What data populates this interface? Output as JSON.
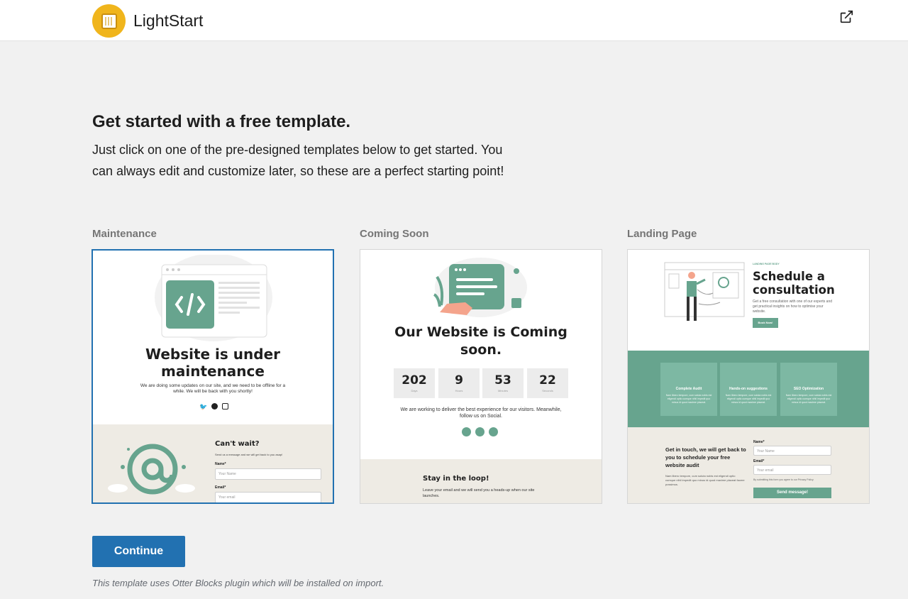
{
  "header": {
    "brand": "LightStart",
    "logo_icon": "lightstart-logo-icon",
    "external_icon": "external-link-icon"
  },
  "intro": {
    "title": "Get started with a free template.",
    "description": "Just click on one of the pre-designed templates below to get started. You can always edit and customize later, so these are a perfect starting point!"
  },
  "templates": [
    {
      "label": "Maintenance",
      "selected": true,
      "preview": {
        "heading": "Website is under maintenance",
        "text": "We are doing some updates on our site, and we need to be offline for a while. We will be back with you shortly!",
        "form_heading": "Can't wait?",
        "form_text": "Send us a message and we will get back to you asap!",
        "name_label": "Name*",
        "name_placeholder": "Your Name",
        "email_label": "Email*",
        "email_placeholder": "Your email"
      }
    },
    {
      "label": "Coming Soon",
      "selected": false,
      "preview": {
        "heading": "Our Website is Coming soon.",
        "countdown": [
          {
            "value": "202",
            "unit": "Days"
          },
          {
            "value": "9",
            "unit": "Hours"
          },
          {
            "value": "53",
            "unit": "Minutes"
          },
          {
            "value": "22",
            "unit": "Seconds"
          }
        ],
        "text": "We are working to deliver the best experience for our visitors. Meanwhile, follow us on Social.",
        "footer_heading": "Stay in the loop!",
        "footer_text": "Leave your email and we will send you a heads-up when our site launches."
      }
    },
    {
      "label": "Landing Page",
      "selected": false,
      "preview": {
        "kicker": "LANDING PAGE BODY",
        "heading": "Schedule a consultation",
        "text": "Get a free consultation with one of our experts and get practical insights on how to optimise your website.",
        "button": "Book Now!",
        "features": [
          {
            "title": "Complete Audit",
            "text": "Nam libero tempore, cum soluta nobis est eligendi optio cumque nihil impedit quo minus id quod maxime placeat."
          },
          {
            "title": "Hands-on suggestions",
            "text": "Nam libero tempore, cum soluta nobis est eligendi optio cumque nihil impedit quo minus id quod maxime placeat."
          },
          {
            "title": "SEO Optimization",
            "text": "Nam libero tempore, cum soluta nobis est eligendi optio cumque nihil impedit quo minus id quod maxime placeat."
          }
        ],
        "contact_heading": "Get in touch, we will get back to you to schedule your free website audit",
        "contact_text": "Nam libero tempore, cum soluta nobis est eligendi optio cumque nihil impedit quo minus id quod maxime placeat facere possimus.",
        "name_label": "Name*",
        "name_placeholder": "Your Name",
        "email_label": "Email*",
        "email_placeholder": "Your email",
        "consent": "By submitting this form you agree to our Privacy Policy.",
        "submit": "Send message!"
      }
    }
  ],
  "actions": {
    "continue": "Continue",
    "note": "This template uses Otter Blocks plugin which will be installed on import."
  },
  "colors": {
    "accent": "#2271b1",
    "green": "#67a48e",
    "logo": "#f0b51c"
  }
}
